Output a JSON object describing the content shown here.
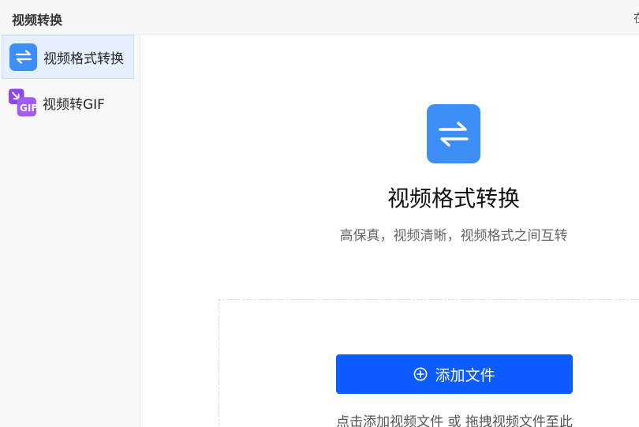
{
  "app": {
    "title": "视频转换",
    "top_right_text": "在"
  },
  "sidebar": {
    "items": [
      {
        "label": "视频格式转换",
        "icon": "swap-arrows-icon",
        "active": true
      },
      {
        "label": "视频转GIF",
        "icon": "gif-icon",
        "icon_text": "GIF",
        "active": false
      }
    ]
  },
  "main": {
    "icon": "swap-arrows-icon",
    "title": "视频格式转换",
    "subtitle": "高保真，视频清晰，视频格式之间互转",
    "add_button": {
      "label": "添加文件",
      "icon": "plus-circle-icon"
    },
    "drop_hint": "点击添加视频文件 或 拖拽视频文件至此"
  },
  "colors": {
    "accent": "#0c5cff",
    "icon_blue": "#3d8ff7",
    "gif_purple": "#8b46f2",
    "active_bg": "#e4efff"
  }
}
